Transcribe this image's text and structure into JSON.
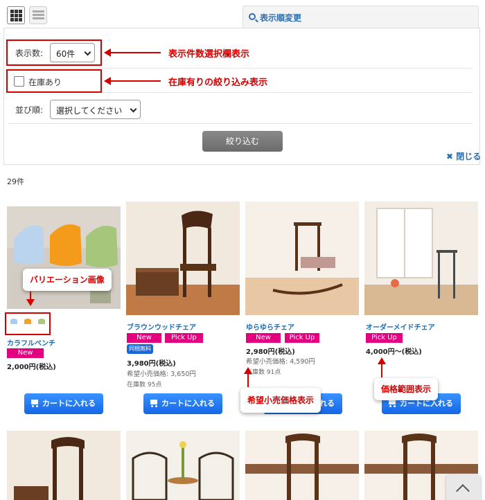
{
  "toolbar": {
    "grid_icon": "grid-view-icon",
    "list_icon": "list-view-icon"
  },
  "sort_tab": {
    "label": "表示順変更",
    "icon": "search-icon"
  },
  "filter_panel": {
    "display_count_label": "表示数:",
    "display_count_value": "60件",
    "in_stock_label": "在庫あり",
    "sort_label": "並び順:",
    "sort_value": "選択してください",
    "filter_button": "絞り込む",
    "close_link": "閉じる"
  },
  "annotations": {
    "count_select": "表示件数選択欄表示",
    "in_stock_filter": "在庫有りの絞り込み表示",
    "variation_image": "バリエーション画像",
    "msrp": "希望小売価格表示",
    "price_range": "価格範囲表示"
  },
  "result_count": "29件",
  "products": [
    {
      "name": "カラフルベンチ",
      "badges": [
        "New"
      ],
      "price": "2,000円(税込)",
      "cart_label": "カートに入れる"
    },
    {
      "name": "ブラウンウッドチェア",
      "badges": [
        "New",
        "Pick Up"
      ],
      "shipping_badge": "同梱無料",
      "price": "3,980円(税込)",
      "msrp": "希望小売価格: 3,650円",
      "stock": "在庫数 95点",
      "cart_label": "カートに入れる"
    },
    {
      "name": "ゆらゆらチェア",
      "badges": [
        "New",
        "Pick Up"
      ],
      "price": "2,980円(税込)",
      "msrp": "希望小売価格: 4,590円",
      "stock": "在庫数 91点",
      "cart_label": "カートに入れる"
    },
    {
      "name": "オーダーメイドチェア",
      "badges": [
        "Pick Up"
      ],
      "price": "4,000円～(税込)",
      "cart_label": "カートに入れる"
    }
  ],
  "colors": {
    "accent_red": "#d40000",
    "link_blue": "#1a6db3",
    "badge_pink": "#e3007f",
    "cart_blue": "#1466e6"
  }
}
